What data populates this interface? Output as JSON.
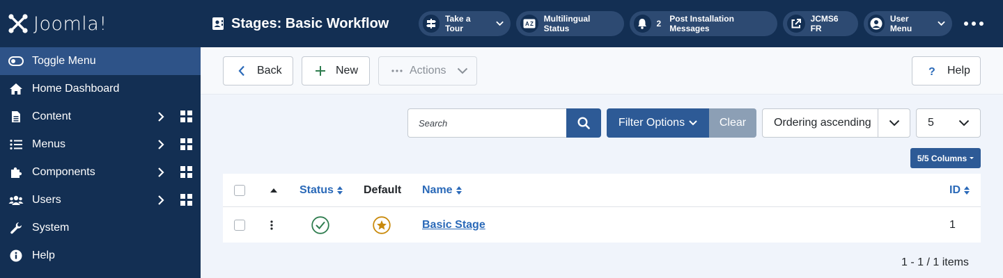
{
  "brand": {
    "name": "Joomla!"
  },
  "header": {
    "page_title": "Stages: Basic Workflow",
    "take_tour": "Take a Tour",
    "multilingual": "Multilingual Status",
    "post_install_count": "2",
    "post_install": "Post Installation Messages",
    "site_name": "JCMS6 FR",
    "user_menu": "User Menu"
  },
  "sidebar": {
    "items": [
      {
        "label": "Toggle Menu",
        "icon": "toggle-icon"
      },
      {
        "label": "Home Dashboard",
        "icon": "home-icon"
      },
      {
        "label": "Content",
        "icon": "file-icon"
      },
      {
        "label": "Menus",
        "icon": "list-icon"
      },
      {
        "label": "Components",
        "icon": "puzzle-icon"
      },
      {
        "label": "Users",
        "icon": "users-icon"
      },
      {
        "label": "System",
        "icon": "wrench-icon"
      },
      {
        "label": "Help",
        "icon": "info-icon"
      }
    ]
  },
  "toolbar": {
    "back": "Back",
    "new": "New",
    "actions": "Actions",
    "help": "Help"
  },
  "filters": {
    "search_placeholder": "Search",
    "filter_options": "Filter Options",
    "clear": "Clear",
    "ordering": "Ordering ascending",
    "limit": "5",
    "columns": "5/5 Columns"
  },
  "table": {
    "headers": {
      "status": "Status",
      "default": "Default",
      "name": "Name",
      "id": "ID"
    },
    "rows": [
      {
        "name": "Basic Stage",
        "id": "1",
        "status": "published",
        "default": true
      }
    ]
  },
  "pagination": {
    "info": "1 - 1 / 1 items"
  },
  "colors": {
    "header_bg": "#132f53",
    "accent": "#2d5a96",
    "link": "#2a69b8",
    "success": "#2f7d4f",
    "default_star": "#c98a0c"
  }
}
